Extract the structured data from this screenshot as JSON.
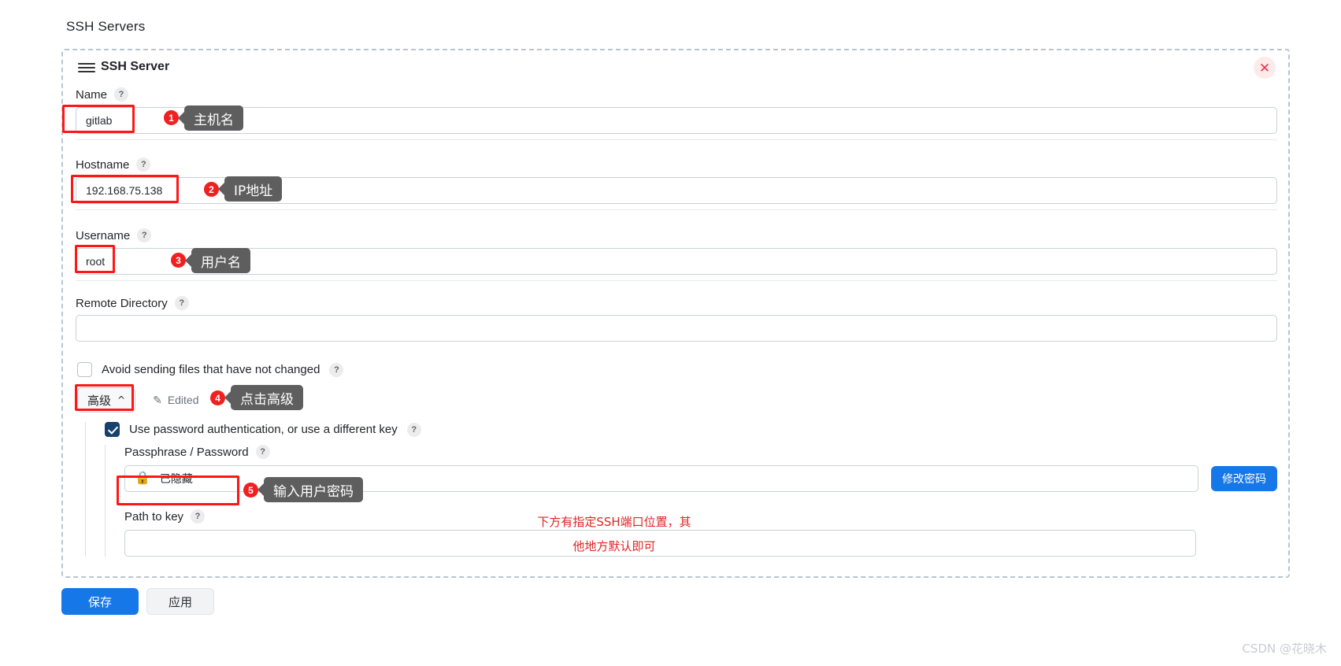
{
  "page": {
    "title": "SSH Servers",
    "watermark": "CSDN @花晓木"
  },
  "panel": {
    "title": "SSH Server",
    "menu_icon": "hamburger-icon",
    "close_icon": "close-icon"
  },
  "fields": {
    "name": {
      "label": "Name",
      "value": "gitlab",
      "help": "?"
    },
    "hostname": {
      "label": "Hostname",
      "value": "192.168.75.138",
      "help": "?"
    },
    "username": {
      "label": "Username",
      "value": "root",
      "help": "?"
    },
    "remote_directory": {
      "label": "Remote Directory",
      "value": "",
      "placeholder": "",
      "help": "?"
    },
    "path_to_key": {
      "label": "Path to key",
      "value": "",
      "placeholder": "",
      "help": "?"
    },
    "passphrase": {
      "label": "Passphrase / Password",
      "value": "已隐藏",
      "help": "?",
      "lock_icon": "lock-icon"
    }
  },
  "checkboxes": {
    "avoid_sending": {
      "label": "Avoid sending files that have not changed",
      "checked": false,
      "help": "?"
    },
    "use_password_auth": {
      "label": "Use password authentication, or use a different key",
      "checked": true,
      "help": "?"
    }
  },
  "advanced": {
    "button_label": "高级",
    "chevron": "chevron-up-icon",
    "edited_label": "Edited",
    "edit_icon": "pencil-icon"
  },
  "buttons": {
    "change_password": "修改密码",
    "save": "保存",
    "apply": "应用"
  },
  "annotations": [
    {
      "number": "1",
      "text": "主机名"
    },
    {
      "number": "2",
      "text": "IP地址"
    },
    {
      "number": "3",
      "text": "用户名"
    },
    {
      "number": "4",
      "text": "点击高级"
    },
    {
      "number": "5",
      "text": "输入用户密码"
    }
  ],
  "red_note": {
    "line1": "下方有指定SSH端口位置，其",
    "line2": "他地方默认即可"
  },
  "colors": {
    "highlight": "#ff1616",
    "badge": "#f02020",
    "callout": "#5e5e5e",
    "primary": "#1677e8",
    "checkbox_checked": "#17406b",
    "note": "#e02424"
  }
}
